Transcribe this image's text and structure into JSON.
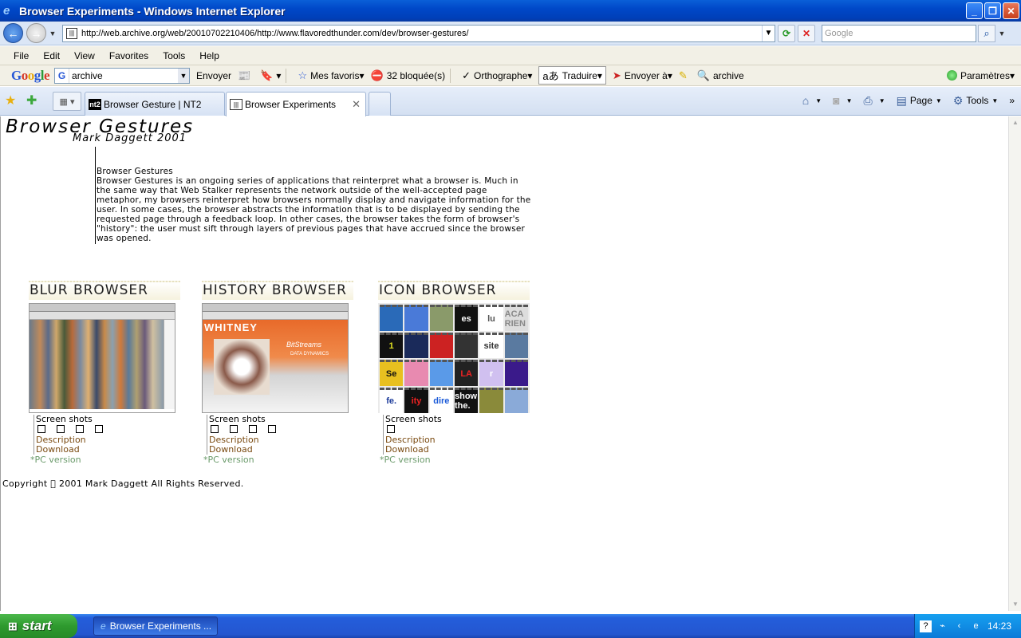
{
  "window": {
    "title": "Browser Experiments - Windows Internet Explorer"
  },
  "address": {
    "url": "http://web.archive.org/web/20010702210406/http://www.flavoredthunder.com/dev/browser-gestures/"
  },
  "search": {
    "placeholder": "Google"
  },
  "menu": [
    "File",
    "Edit",
    "View",
    "Favorites",
    "Tools",
    "Help"
  ],
  "google_toolbar": {
    "search_value": "archive",
    "send": "Envoyer",
    "favorites": "Mes favoris",
    "blocked": "32 bloquée(s)",
    "spell": "Orthographe",
    "translate": "Traduire",
    "send_to": "Envoyer à",
    "archive": "archive",
    "settings": "Paramètres"
  },
  "tabs": [
    {
      "label": "Browser Gesture | NT2",
      "icon": "nt2"
    },
    {
      "label": "Browser Experiments",
      "icon": "archive"
    }
  ],
  "command_bar": {
    "page": "Page",
    "tools": "Tools"
  },
  "page": {
    "title": "Browser Gestures",
    "subtitle": "Mark Daggett 2001",
    "intro_heading": "Browser Gestures",
    "intro_body": "Browser Gestures is an ongoing series of applications that reinterpret what a browser is. Much in the same way that Web Stalker represents the network outside of the well-accepted page metaphor, my browsers reinterpret how browsers normally display and navigate information for the user. In some cases, the browser abstracts the information that is to be displayed by sending the requested page through a feedback loop. In other cases, the browser takes the form of browser's \"history\": the user must sift through layers of previous pages that have accrued since the browser was opened.",
    "columns": [
      {
        "title": "BLUR BROWSER",
        "screenshots": "Screen shots",
        "checks": 4,
        "description": "Description",
        "download": "Download",
        "pc": "*PC version"
      },
      {
        "title": "HISTORY BROWSER",
        "screenshots": "Screen shots",
        "checks": 4,
        "description": "Description",
        "download": "Download",
        "pc": "*PC version",
        "banner": "WHITNEY",
        "art_text": "BitStreams",
        "art_sub": "DATA DYNAMICS"
      },
      {
        "title": "ICON BROWSER",
        "screenshots": "Screen shots",
        "checks": 1,
        "description": "Description",
        "download": "Download",
        "pc": "*PC version",
        "tiles": [
          "",
          "",
          "",
          "es",
          "lu",
          "ACA RIEN",
          "1",
          "",
          "",
          "",
          "site",
          "",
          "Se",
          "",
          "",
          "LA",
          "r",
          "",
          "fe.",
          "ity",
          "dire",
          "show the.",
          "",
          ""
        ]
      }
    ],
    "copyright": "Copyright \u0000 2001 Mark Daggett All Rights Reserved."
  },
  "taskbar": {
    "start": "start",
    "task": "Browser Experiments ...",
    "clock": "14:23"
  }
}
